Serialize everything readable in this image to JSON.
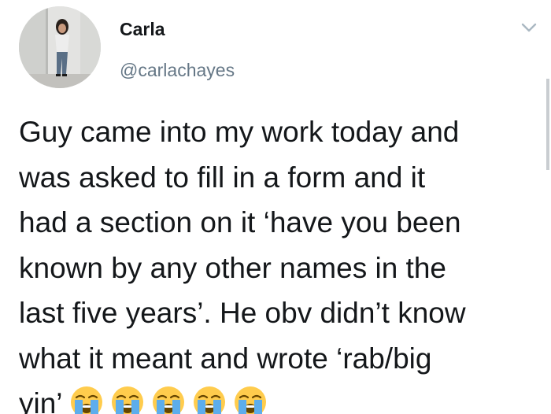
{
  "tweet": {
    "display_name": "Carla",
    "handle": "@carlachayes",
    "lines": [
      "Guy came into my work today and",
      "was asked to fill in a form and it",
      "had a section on it ‘have you been",
      "known by any other names in the",
      "last five years’. He obv didn’t know",
      "what it meant and wrote ‘rab/big",
      "yin’"
    ],
    "emojis": [
      "crying-face",
      "crying-face",
      "crying-face",
      "crying-face",
      "crying-face"
    ]
  },
  "icons": {
    "menu": "chevron-down-icon"
  },
  "colors": {
    "text": "#14171a",
    "handle": "#657786",
    "chevron": "#aab8c2",
    "emoji_face": "#ffcc4d",
    "emoji_tears": "#5dadec"
  }
}
